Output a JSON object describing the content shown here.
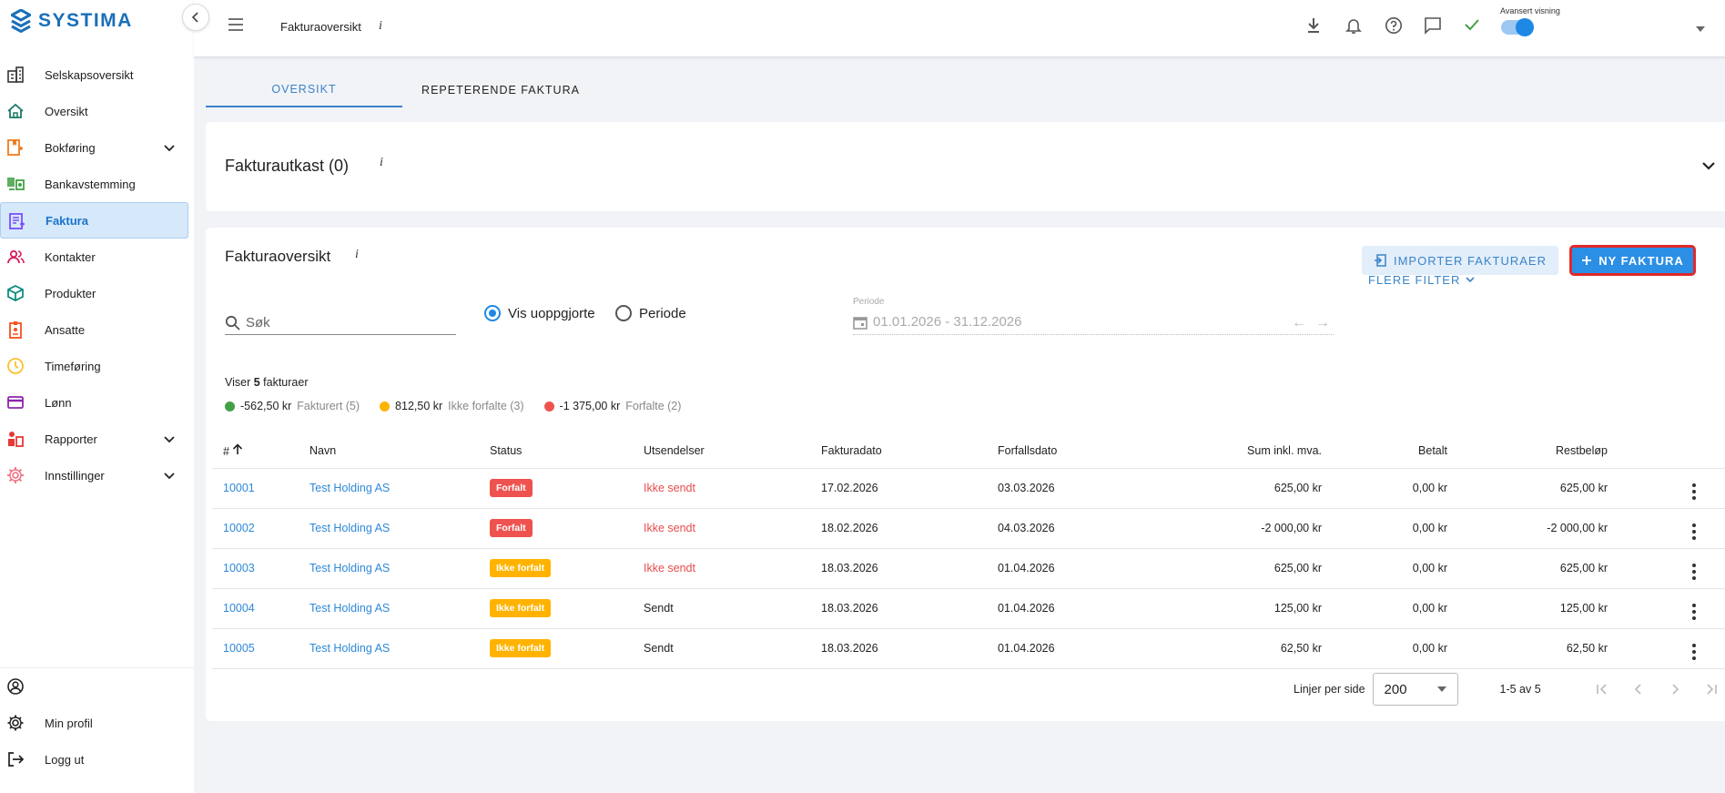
{
  "app": {
    "logo_text": "SYSTIMA"
  },
  "sidebar": {
    "items": [
      {
        "label": "Selskapsoversikt",
        "icon": "buildings-icon",
        "color": "#333333"
      },
      {
        "label": "Oversikt",
        "icon": "home-icon",
        "color": "#1b7a6b"
      },
      {
        "label": "Bokføring",
        "icon": "ledger-icon",
        "color": "#f07c1f",
        "expandable": true
      },
      {
        "label": "Bankavstemming",
        "icon": "bank-icon",
        "color": "#43a047"
      },
      {
        "label": "Faktura",
        "icon": "invoice-icon",
        "color": "#7c4dff",
        "active": true
      },
      {
        "label": "Kontakter",
        "icon": "contacts-icon",
        "color": "#d81b60"
      },
      {
        "label": "Produkter",
        "icon": "product-box-icon",
        "color": "#00897b"
      },
      {
        "label": "Ansatte",
        "icon": "employee-badge-icon",
        "color": "#f4511e"
      },
      {
        "label": "Timeføring",
        "icon": "clock-icon",
        "color": "#fbc02d"
      },
      {
        "label": "Lønn",
        "icon": "payroll-card-icon",
        "color": "#8e24aa"
      },
      {
        "label": "Rapporter",
        "icon": "reports-icon",
        "color": "#e53935",
        "expandable": true
      },
      {
        "label": "Innstillinger",
        "icon": "settings-gear-icon",
        "color": "#ef6f7f",
        "expandable": true
      }
    ],
    "bottom": [
      {
        "label": "",
        "icon": "user-circle-icon"
      },
      {
        "label": "Min profil",
        "icon": "gear-icon"
      },
      {
        "label": "Logg ut",
        "icon": "logout-icon"
      }
    ]
  },
  "topbar": {
    "title": "Fakturaoversikt",
    "info": "i",
    "advanced_label": "Avansert visning",
    "advanced_on": true
  },
  "tabs": [
    {
      "label": "OVERSIKT",
      "active": true
    },
    {
      "label": "REPETERENDE FAKTURA",
      "active": false
    }
  ],
  "draft": {
    "title": "Fakturautkast (0)",
    "info": "i"
  },
  "overview": {
    "title": "Fakturaoversikt",
    "info": "i",
    "import_label": "IMPORTER FAKTURAER",
    "new_label": "NY FAKTURA",
    "search_placeholder": "Søk",
    "radio_unsettled": "Vis uoppgjorte",
    "radio_period": "Periode",
    "period_label": "Periode",
    "period_value": "01.01.2026 - 31.12.2026",
    "more_filter": "FLERE FILTER",
    "count_prefix": "Viser ",
    "count_value": "5",
    "count_suffix": " fakturaer",
    "legend": [
      {
        "amount": "-562,50 kr",
        "label": "Fakturert (5)",
        "color": "#43a047"
      },
      {
        "amount": "812,50 kr",
        "label": "Ikke forfalte (3)",
        "color": "#ffb300"
      },
      {
        "amount": "-1 375,00 kr",
        "label": "Forfalte (2)",
        "color": "#ef5350"
      }
    ]
  },
  "table": {
    "columns": [
      "#",
      "Navn",
      "Status",
      "Utsendelser",
      "Fakturadato",
      "Forfallsdato",
      "Sum inkl. mva.",
      "Betalt",
      "Restbeløp"
    ],
    "rows": [
      {
        "num": "10001",
        "name": "Test Holding AS",
        "status": "Forfalt",
        "status_color": "red",
        "sent": "Ikke sendt",
        "sent_flag": false,
        "invoice_date": "17.02.2026",
        "due_date": "03.03.2026",
        "sum": "625,00 kr",
        "paid": "0,00 kr",
        "rest": "625,00 kr"
      },
      {
        "num": "10002",
        "name": "Test Holding AS",
        "status": "Forfalt",
        "status_color": "red",
        "sent": "Ikke sendt",
        "sent_flag": false,
        "invoice_date": "18.02.2026",
        "due_date": "04.03.2026",
        "sum": "-2 000,00 kr",
        "paid": "0,00 kr",
        "rest": "-2 000,00 kr"
      },
      {
        "num": "10003",
        "name": "Test Holding AS",
        "status": "Ikke forfalt",
        "status_color": "yellow",
        "sent": "Ikke sendt",
        "sent_flag": false,
        "invoice_date": "18.03.2026",
        "due_date": "01.04.2026",
        "sum": "625,00 kr",
        "paid": "0,00 kr",
        "rest": "625,00 kr"
      },
      {
        "num": "10004",
        "name": "Test Holding AS",
        "status": "Ikke forfalt",
        "status_color": "yellow",
        "sent": "Sendt",
        "sent_flag": true,
        "invoice_date": "18.03.2026",
        "due_date": "01.04.2026",
        "sum": "125,00 kr",
        "paid": "0,00 kr",
        "rest": "125,00 kr"
      },
      {
        "num": "10005",
        "name": "Test Holding AS",
        "status": "Ikke forfalt",
        "status_color": "yellow",
        "sent": "Sendt",
        "sent_flag": true,
        "invoice_date": "18.03.2026",
        "due_date": "01.04.2026",
        "sum": "62,50 kr",
        "paid": "0,00 kr",
        "rest": "62,50 kr"
      }
    ]
  },
  "pagination": {
    "rows_per_page_label": "Linjer per side",
    "rows_per_page_value": "200",
    "range": "1-5 av 5"
  }
}
